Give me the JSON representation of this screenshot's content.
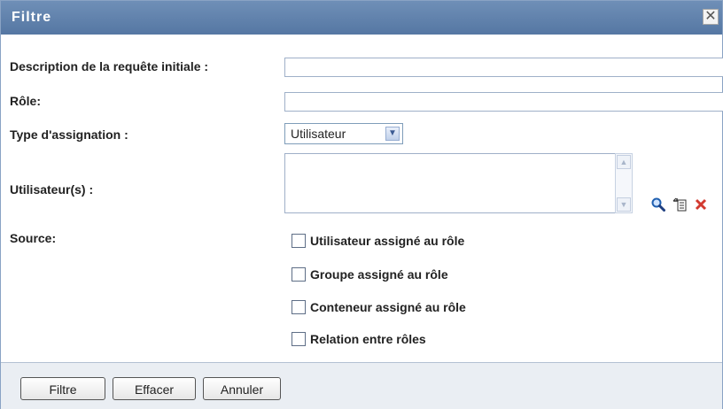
{
  "dialog": {
    "title": "Filtre",
    "close_symbol": "✕"
  },
  "form": {
    "query_description": {
      "label": "Description de la requête initiale :",
      "value": ""
    },
    "role": {
      "label": "Rôle:",
      "value": ""
    },
    "assignment_type": {
      "label": "Type d'assignation :",
      "selected": "Utilisateur"
    },
    "users": {
      "label": "Utilisateur(s) :",
      "value": ""
    },
    "source": {
      "label": "Source:",
      "options": [
        {
          "label": "Utilisateur assigné au rôle",
          "checked": false
        },
        {
          "label": "Groupe assigné au rôle",
          "checked": false
        },
        {
          "label": "Conteneur assigné au rôle",
          "checked": false
        },
        {
          "label": "Relation entre rôles",
          "checked": false
        }
      ]
    }
  },
  "icons": {
    "search": "magnifier-icon",
    "history": "history-list-icon",
    "clear": "delete-x-icon"
  },
  "footer": {
    "filter_label": "Filtre",
    "clear_label": "Effacer",
    "cancel_label": "Annuler"
  },
  "colors": {
    "titlebar": "#5f80aa",
    "footer": "#eaeef3",
    "delete_red": "#d23a2f"
  }
}
